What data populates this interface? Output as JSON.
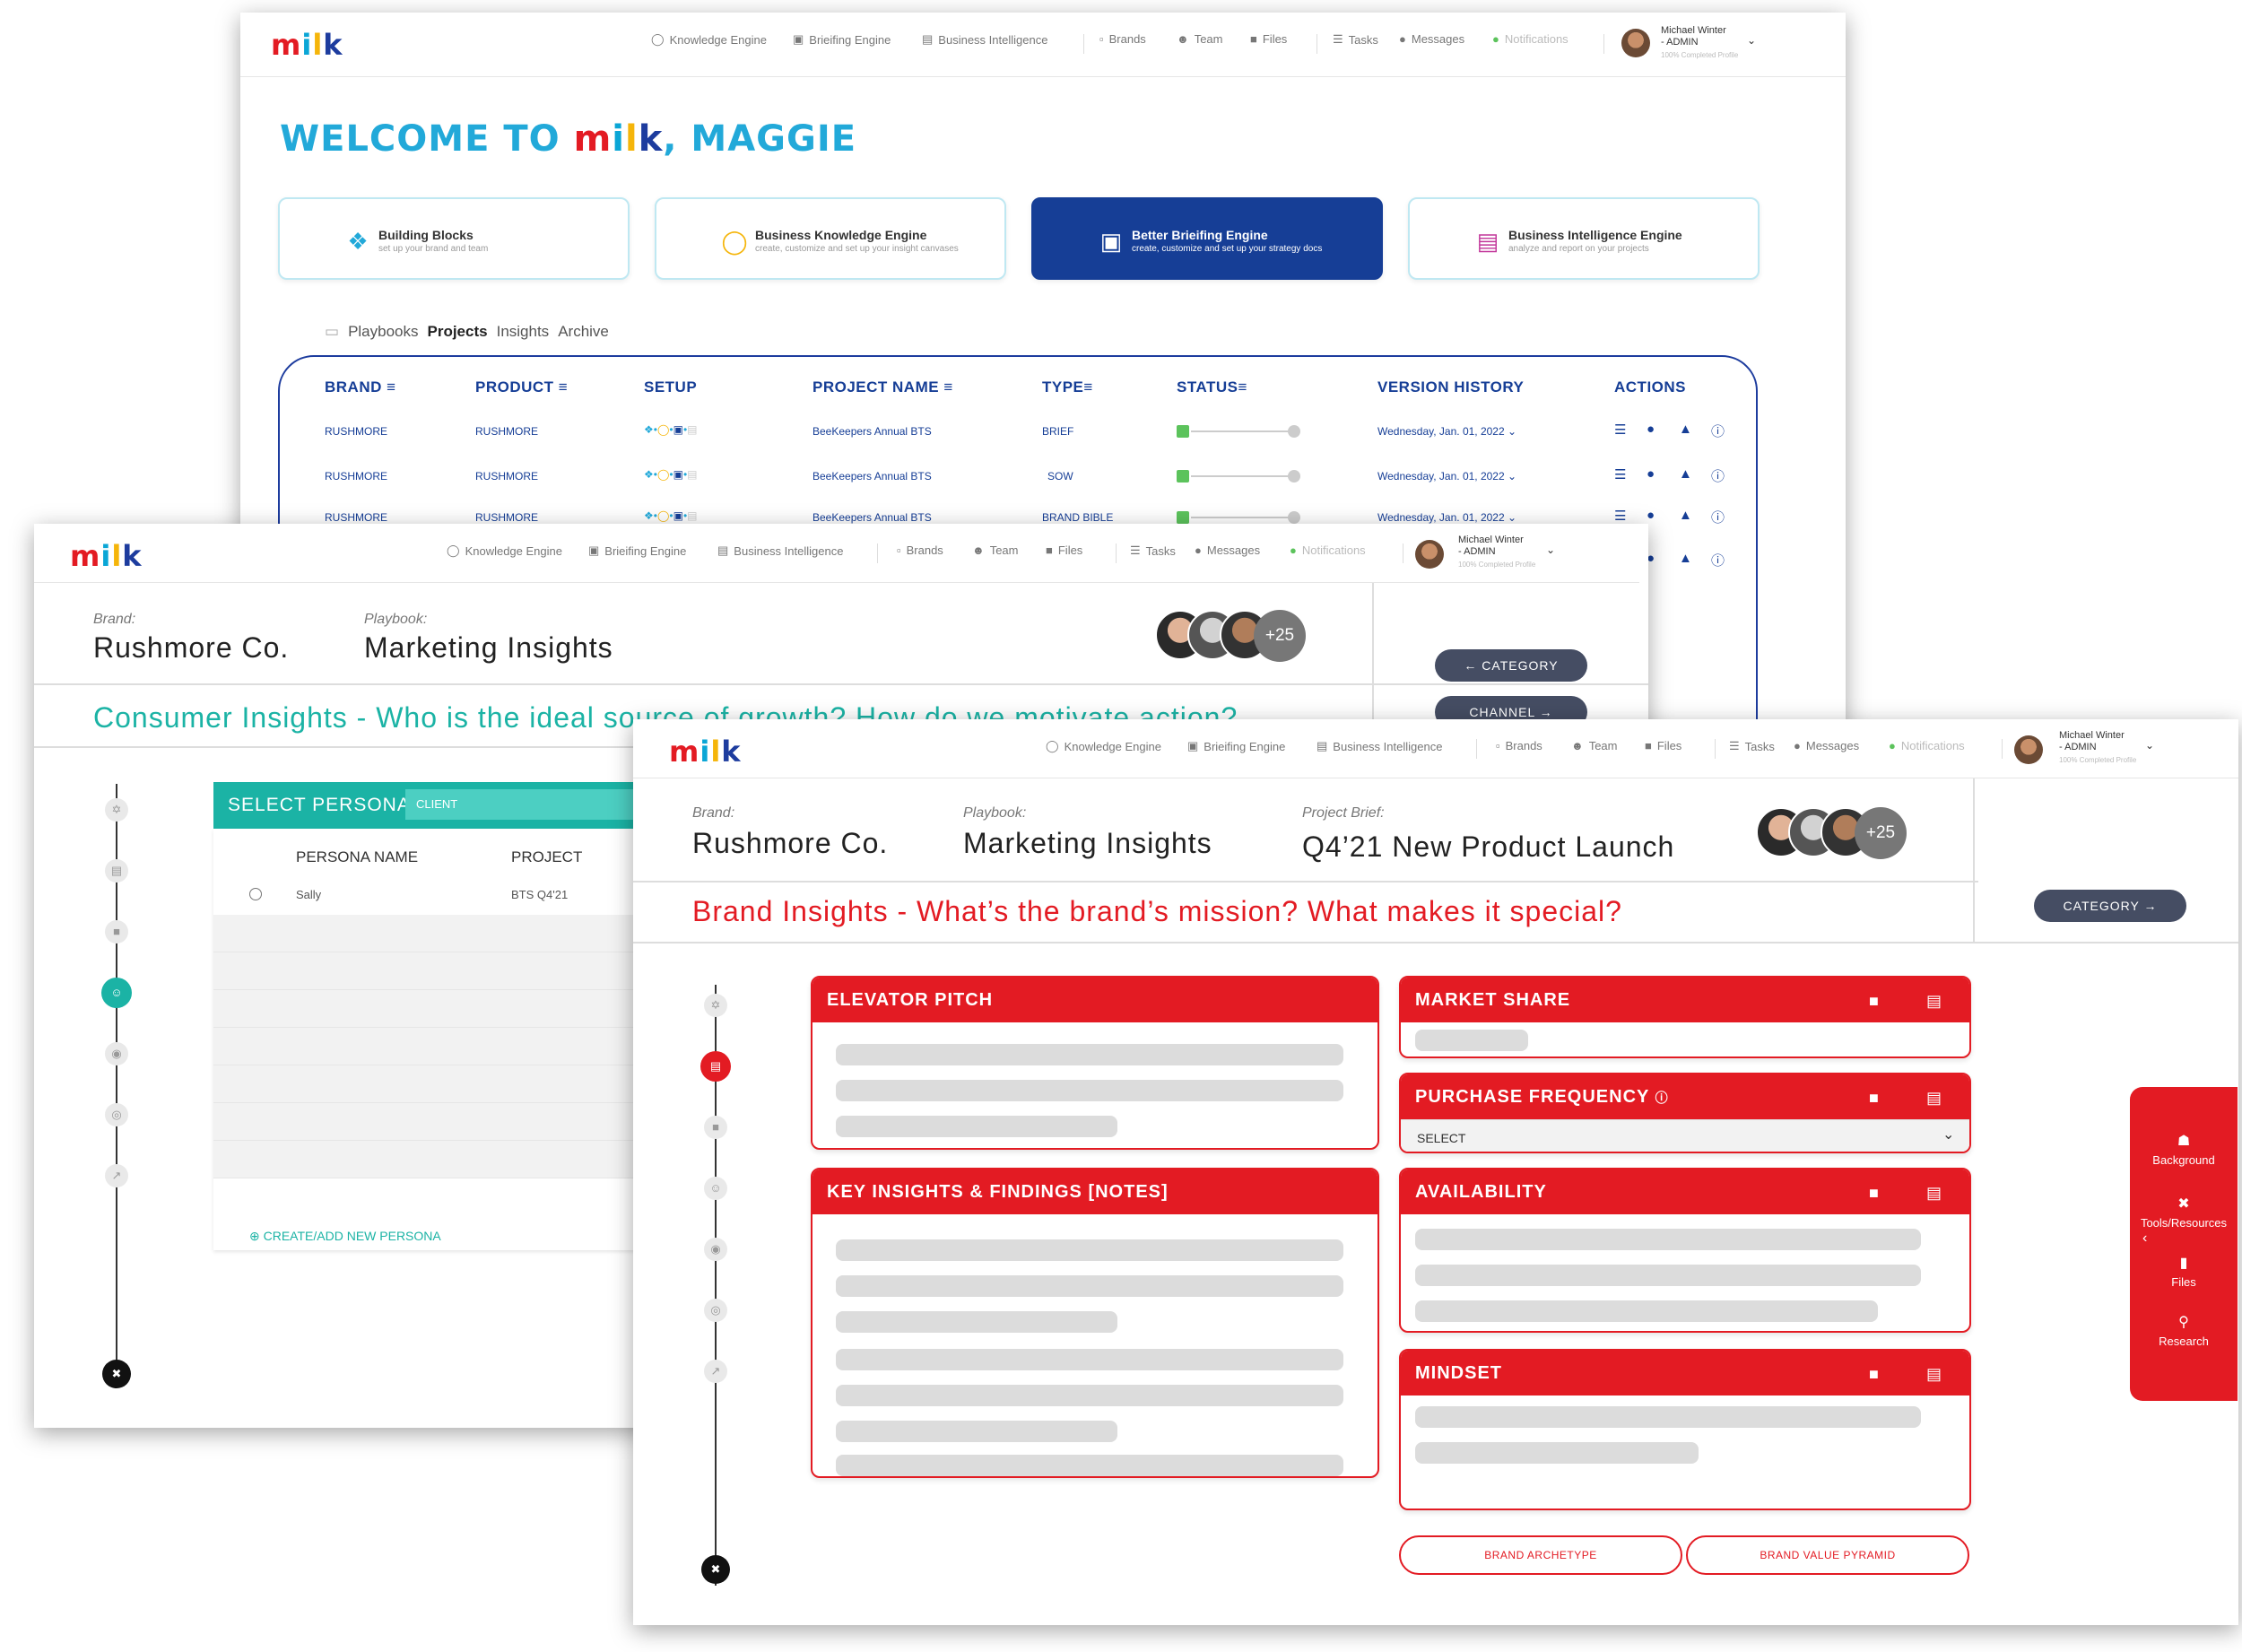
{
  "nav": {
    "logo": [
      "m",
      "i",
      "l",
      "k"
    ],
    "items": {
      "knowledge": "Knowledge Engine",
      "briefing": "Brieifing Engine",
      "bi": "Business Intelligence",
      "brands": "Brands",
      "team": "Team",
      "files": "Files",
      "tasks": "Tasks",
      "messages": "Messages",
      "notifications": "Notifications"
    },
    "user": {
      "name": "Michael Winter",
      "role": "- ADMIN",
      "profile": "100% Completed Profile"
    }
  },
  "dashboard": {
    "welcome_prefix": "WELCOME TO ",
    "welcome_suffix": ", MAGGIE",
    "cards": [
      {
        "title": "Building Blocks",
        "subtitle": "set up your brand and team",
        "icon": "cubes-icon",
        "color": "#22a9d9"
      },
      {
        "title": "Business Knowledge Engine",
        "subtitle": "create, customize and set up your insight canvases",
        "icon": "lightbulb-icon",
        "color": "#f5b50a"
      },
      {
        "title": "Better Brieifing Engine",
        "subtitle": "create, customize and set up your strategy docs",
        "icon": "board-icon",
        "color": "#ffffff"
      },
      {
        "title": "Business Intelligence Engine",
        "subtitle": "analyze and report on your projects",
        "icon": "chart-clipboard-icon",
        "color": "#c2369a"
      }
    ],
    "subtabs": [
      "Playbooks",
      "Projects",
      "Insights",
      "Archive"
    ],
    "columns": [
      "BRAND",
      "PRODUCT",
      "SETUP",
      "PROJECT NAME",
      "TYPE",
      "STATUS",
      "VERSION HISTORY",
      "ACTIONS"
    ],
    "rows": [
      {
        "brand": "RUSHMORE",
        "product": "RUSHMORE",
        "project": "BeeKeepers Annual BTS",
        "type": "BRIEF",
        "version": "Wednesday, Jan. 01, 2022"
      },
      {
        "brand": "RUSHMORE",
        "product": "RUSHMORE",
        "project": "BeeKeepers Annual BTS",
        "type": "SOW",
        "version": "Wednesday, Jan. 01, 2022"
      },
      {
        "brand": "RUSHMORE",
        "product": "RUSHMORE",
        "project": "BeeKeepers Annual BTS",
        "type": "BRAND BIBLE",
        "version": "Wednesday, Jan. 01, 2022"
      }
    ]
  },
  "consumer": {
    "brand_label": "Brand:",
    "brand": "Rushmore Co.",
    "playbook_label": "Playbook:",
    "playbook": "Marketing Insights",
    "avatar_more": "+25",
    "title": "Consumer Insights - Who is the ideal source of growth? How do we motivate action?",
    "category_btn": "CATEGORY",
    "channel_btn": "CHANNEL",
    "persona_header": "SELECT PERSONA",
    "persona_filter": "CLIENT",
    "persona_cols": [
      "PERSONA NAME",
      "PROJECT"
    ],
    "persona_rows": [
      {
        "name": "Sally",
        "project": "BTS Q4'21"
      }
    ],
    "create_persona": "CREATE/ADD NEW PERSONA"
  },
  "brief": {
    "brand_label": "Brand:",
    "brand": "Rushmore Co.",
    "playbook_label": "Playbook:",
    "playbook": "Marketing Insights",
    "project_label": "Project Brief:",
    "project": "Q4’21 New Product Launch",
    "avatar_more": "+25",
    "title": "Brand Insights - What’s the brand’s mission? What makes it special?",
    "category_btn": "CATEGORY",
    "panels": {
      "elevator": "ELEVATOR PITCH",
      "key_insights": "KEY INSIGHTS & FINDINGS [NOTES]",
      "market_share": "MARKET SHARE",
      "purchase_frequency": "PURCHASE FREQUENCY",
      "purchase_select": "SELECT",
      "availability": "AVAILABILITY",
      "mindset": "MINDSET"
    },
    "buttons": {
      "archetype": "BRAND ARCHETYPE",
      "pyramid": "BRAND VALUE PYRAMID"
    },
    "side_panel": [
      "Background",
      "Tools/Resources",
      "Files",
      "Research"
    ]
  },
  "colors": {
    "navy": "#163e96",
    "teal": "#1bb3a5",
    "red": "#e31b23",
    "slate": "#454d63"
  }
}
